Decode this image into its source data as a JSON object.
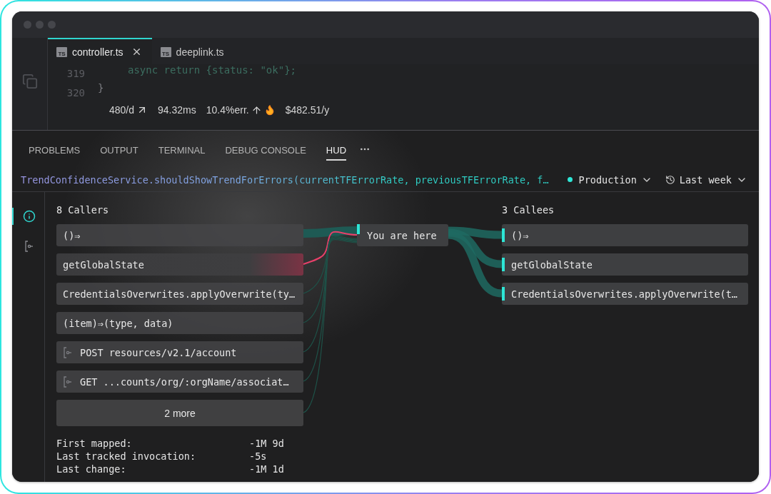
{
  "editor_tabs": [
    {
      "icon_text": "TS",
      "label": "controller.ts",
      "selected": true,
      "closable": true
    },
    {
      "icon_text": "TS",
      "label": "deeplink.ts",
      "selected": false,
      "closable": false
    }
  ],
  "editor": {
    "line_numbers": [
      "319",
      "320"
    ],
    "code_lines": [
      "async return {status: \"ok\"};",
      "}"
    ],
    "metrics": [
      {
        "text": "480/d",
        "kind": "trending"
      },
      {
        "text": "94.32ms",
        "kind": "plain"
      },
      {
        "text": "10.4%err.",
        "kind": "alert"
      },
      {
        "text": "$482.51/y",
        "kind": "plain"
      }
    ]
  },
  "panel_tabs": [
    {
      "label": "PROBLEMS",
      "selected": false
    },
    {
      "label": "OUTPUT",
      "selected": false
    },
    {
      "label": "TERMINAL",
      "selected": false
    },
    {
      "label": "DEBUG CONSOLE",
      "selected": false
    },
    {
      "label": "HUD",
      "selected": true
    }
  ],
  "breadcrumb": "TrendConfidenceService.shouldShowTrendForErrors(currentTFErrorRate, previousTFErrorRate, f…",
  "environment": {
    "label": "Production",
    "color": "#2ee6d6"
  },
  "range": {
    "label": "Last week"
  },
  "side_icons": [
    {
      "kind": "info",
      "selected": true
    },
    {
      "kind": "endpoint",
      "selected": false
    }
  ],
  "callers": {
    "title": "8 Callers",
    "items": [
      {
        "kind": "function",
        "label": "()⇒",
        "highlighted": false
      },
      {
        "kind": "function",
        "label": "getGlobalState",
        "highlighted": true
      },
      {
        "kind": "function",
        "label": "CredentialsOverwrites.applyOverwrite(ty…",
        "highlighted": false
      },
      {
        "kind": "function",
        "label": "(item)⇒(type, data)",
        "highlighted": false
      },
      {
        "kind": "endpoint",
        "label": "POST resources/v2.1/account",
        "highlighted": false
      },
      {
        "kind": "endpoint",
        "label": "GET ...counts/org/:orgName/associat…",
        "highlighted": false
      },
      {
        "kind": "more",
        "label": "2 more",
        "highlighted": false
      }
    ]
  },
  "current": {
    "label": "You are here"
  },
  "callees": {
    "title": "3 Callees",
    "items": [
      {
        "label": "()⇒"
      },
      {
        "label": "getGlobalState"
      },
      {
        "label": "CredentialsOverwrites.applyOverwrite(t…"
      }
    ]
  },
  "stats": [
    {
      "label": "First mapped:",
      "value": "-1M 9d"
    },
    {
      "label": "Last tracked invocation:",
      "value": "-5s"
    },
    {
      "label": "Last change:",
      "value": "-1M 1d"
    }
  ]
}
